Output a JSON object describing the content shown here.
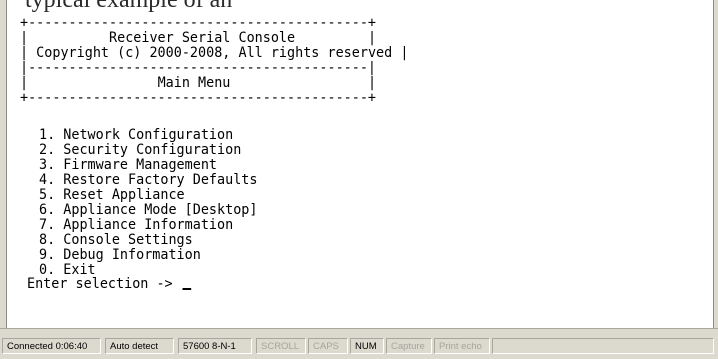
{
  "top_strip": {
    "ghost_text": "typical example of an"
  },
  "console": {
    "frame_lines": [
      "+------------------------------------------+",
      "|          Receiver Serial Console          |",
      "| Copyright (c) 2000-2008, All rights reserved |",
      "|------------------------------------------|",
      "|                Main Menu                 |",
      "+------------------------------------------+"
    ],
    "title": "Receiver Serial Console",
    "copyright": "Copyright (c) 2000-2008, All rights reserved",
    "menu_title": "Main Menu",
    "menu_items": [
      "1. Network Configuration",
      "2. Security Configuration",
      "3. Firmware Management",
      "4. Restore Factory Defaults",
      "5. Reset Appliance",
      "6. Appliance Mode [Desktop]",
      "7. Appliance Information",
      "8. Console Settings",
      "9. Debug Information",
      "0. Exit"
    ],
    "prompt": "Enter selection -> "
  },
  "statusbar": {
    "connection": "Connected 0:06:40",
    "detect": "Auto detect",
    "port_settings": "57600 8-N-1",
    "scroll": "SCROLL",
    "caps": "CAPS",
    "num": "NUM",
    "capture": "Capture",
    "print_echo": "Print echo"
  },
  "colors": {
    "terminal_bg": "#ffffff",
    "terminal_fg": "#000000",
    "chrome": "#dcd9cf",
    "disabled_text": "#a8a59c"
  }
}
